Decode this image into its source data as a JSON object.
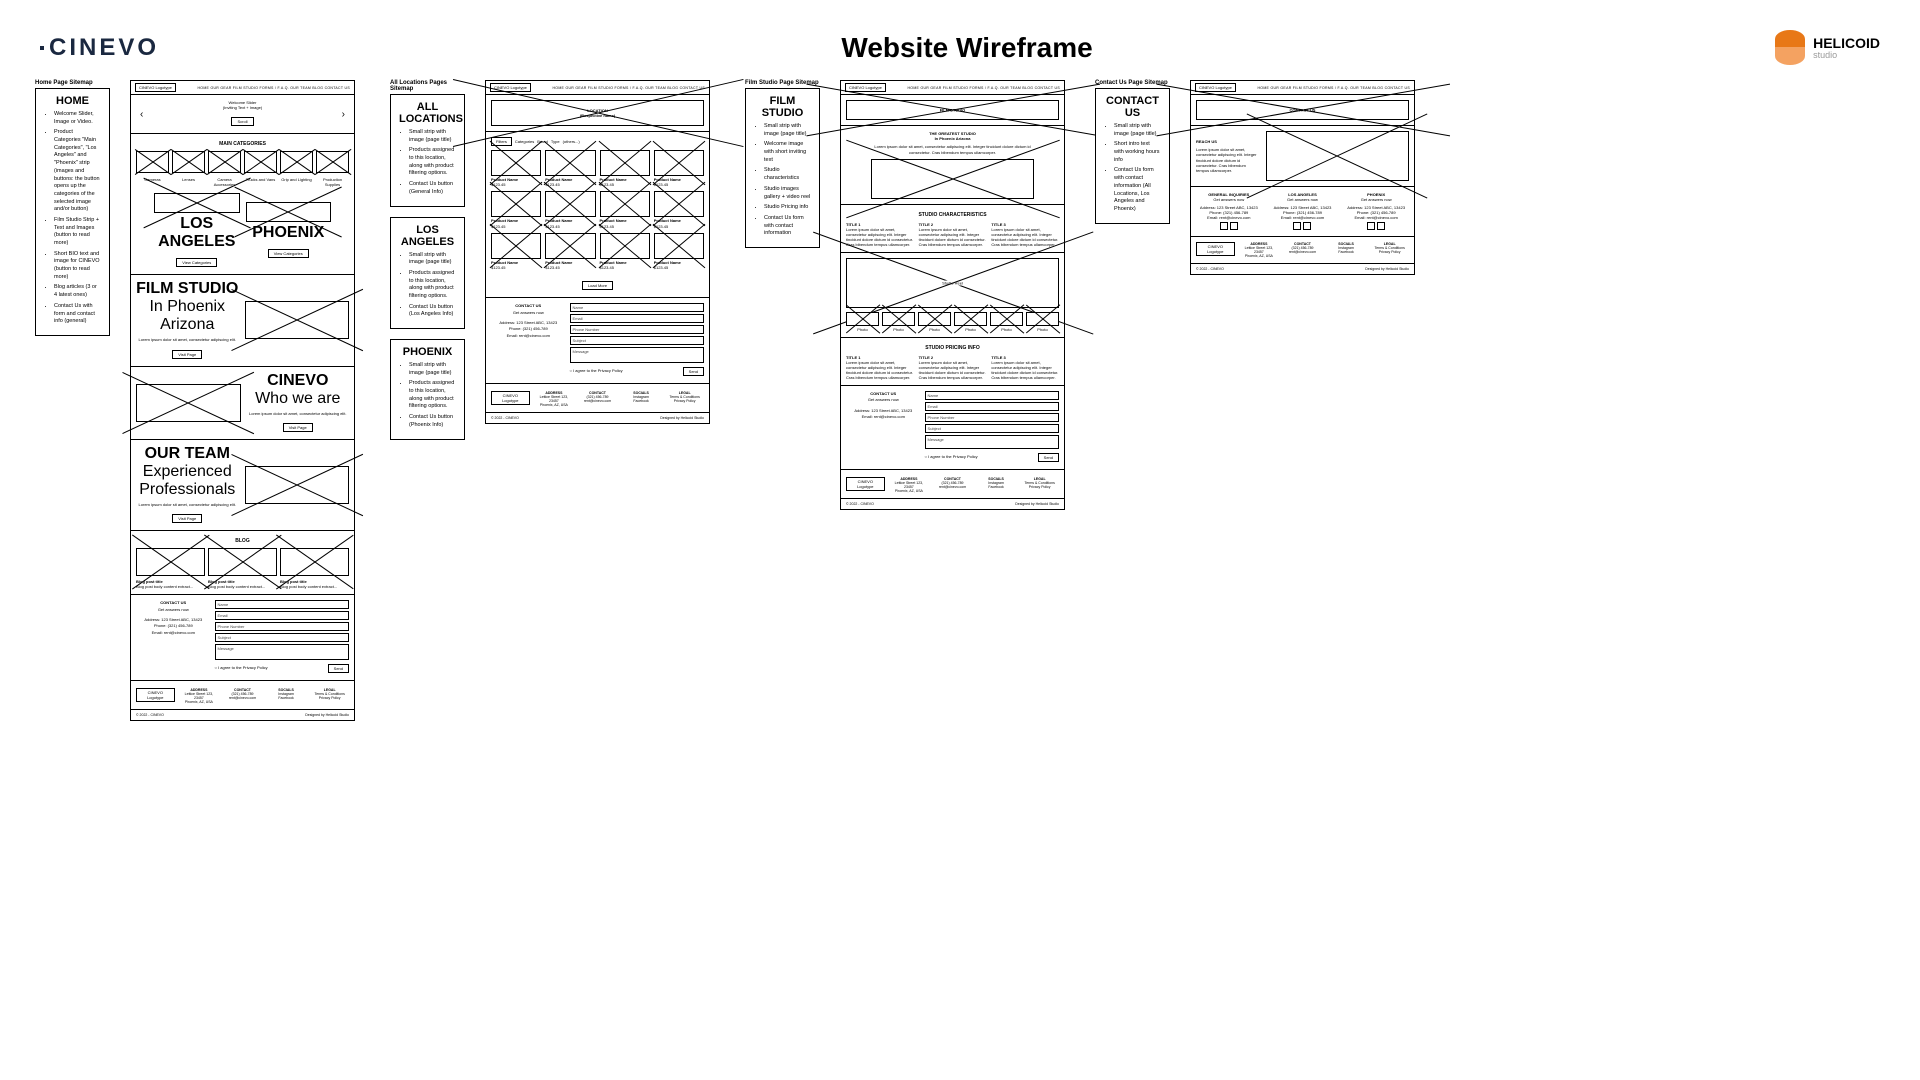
{
  "header": {
    "brand": "CINEVO",
    "title": "Website Wireframe",
    "agency": "HELICOID",
    "agency_sub": "studio"
  },
  "nav": "HOME   OUR GEAR   FILM STUDIO   FORMS / F.A.Q.   OUR TEAM   BLOG   CONTACT US",
  "logotype": "CINEVO Logotype",
  "sitemaps": {
    "home": "Home Page Sitemap",
    "locations": "All Locations Pages Sitemap",
    "studio": "Film Studio Page Sitemap",
    "contact": "Contact Us Page Sitemap"
  },
  "panels": {
    "home": {
      "title": "HOME",
      "bullets": [
        "Welcome Slider, Image or Video.",
        "Product Categories \"Main Categories\", \"Los Angeles\" and \"Phoenix\" strip (images and buttons: the button opens up the categories of the selected image and/or button)",
        "Film Studio Strip + Text and Images (button to read more)",
        "Short BIO text and image for CINEVO (button to read more)",
        "Blog articles (3 or 4 latest ones)",
        "Contact Us with form and contact info (general)"
      ]
    },
    "all_loc": {
      "title": "ALL LOCATIONS",
      "bullets": [
        "Small strip with image (page title)",
        "Products assigned to this location, along with product filtering options.",
        "Contact Us button (General Info)"
      ]
    },
    "la": {
      "title": "LOS ANGELES",
      "bullets": [
        "Small strip with image (page title)",
        "Products assigned to this location, along with product filtering options.",
        "Contact Us button (Los Angeles Info)"
      ]
    },
    "phx": {
      "title": "PHOENIX",
      "bullets": [
        "Small strip with image (page title)",
        "Products assigned to this location, along with product filtering options.",
        "Contact Us button (Phoenix Info)"
      ]
    },
    "studio": {
      "title": "FILM STUDIO",
      "bullets": [
        "Small strip with image (page title)",
        "Welcome image with short inviting text",
        "Studio characteristics",
        "Studio images gallery + video reel",
        "Studio Pricing info",
        "Contact Us form with contact information"
      ]
    },
    "contact": {
      "title": "CONTACT US",
      "bullets": [
        "Small strip with image (page title)",
        "Short intro text with working hours info",
        "Contact Us form with contact information (All Locations, Los Angeles and Phoenix)"
      ]
    }
  },
  "home_wire": {
    "slider": "Welcome Slider\n(Inviting Text + Image)",
    "scroll": "Scroll",
    "main_cat": "MAIN CATEGORIES",
    "cats": [
      "Cameras",
      "Lenses",
      "Camera Accessories",
      "Trucks and Vans",
      "Grip and Lighting",
      "Production Supplies"
    ],
    "la": "LOS ANGELES",
    "phx": "PHOENIX",
    "view_cat": "View Categories",
    "studio_t": "FILM STUDIO",
    "studio_s": "In Phoenix Arizona",
    "lorem": "Lorem ipsum dolor sit amet, consectetur adipiscing elit.",
    "visit": "Visit Page",
    "cinevo_t": "CINEVO",
    "cinevo_s": "Who we are",
    "team_t": "OUR TEAM",
    "team_s": "Experienced Professionals",
    "blog": "BLOG",
    "blog_item": "Blog post title",
    "blog_body": "Blog post body content extract..."
  },
  "contact": {
    "t": "CONTACT US",
    "s": "Get answers now",
    "addr": "Address: 123 Street ABC, 13423",
    "phone": "Phone: (321) 456-789",
    "email": "Email: rent@cinevo.com",
    "f_name": "Name",
    "f_email": "Email",
    "f_phone": "Phone Number",
    "f_subj": "Subject",
    "f_msg": "Message",
    "privacy": "I agree to the Privacy Policy",
    "send": "Send"
  },
  "footer": {
    "addr_t": "ADDRESS",
    "addr": "Lettice Street 123, 23457\nPhoenix, AZ, USA",
    "con_t": "CONTACT",
    "con": "(321) 456-789\nrent@cinevo.com",
    "soc_t": "SOCIALS",
    "soc": "Instagram\nFacebook",
    "leg_t": "LEGAL",
    "leg": "Terms & Conditions\nPrivacy Policy",
    "copy": "© 2022 - CINEVO",
    "design": "Designed by Helicoid Studio"
  },
  "loc_wire": {
    "title": "LOCATION\n(Respective name)",
    "filters": [
      "Filters",
      "Categories",
      "Brand",
      "Type",
      "(others...)"
    ],
    "prod": "Product Name",
    "price": "$123.45",
    "load": "Load More"
  },
  "studio_wire": {
    "t": "FILM STUDIO",
    "greatest": "THE GREATEST STUDIO\nIn Phoenix Arizona",
    "lorem": "Lorem ipsum dolor sit amet, consectetur adipiscing elit. Integer tincidunt dolore dictum id consectetur. Cras bibendum tempus ullamcorper.",
    "char": "STUDIO CHARACTERISTICS",
    "title1": "TITLE 1",
    "title2": "TITLE 2",
    "title3": "TITLE 3",
    "col_lorem": "Lorem ipsum dolor sit amet, consectetur adipiscing elit. Integer tincidunt dolore dictum id consectetur. Cras bibendum tempus ullamcorper.",
    "reel": "Studio Reel",
    "photo": "Photo",
    "pricing": "STUDIO PRICING INFO"
  },
  "contact_wire": {
    "t": "CONTACT US",
    "reach": "REACH US",
    "gen": "GENERAL INQUIRIES",
    "la": "LOS ANGELES",
    "phx": "PHOENIX",
    "sub": "Get answers now"
  }
}
